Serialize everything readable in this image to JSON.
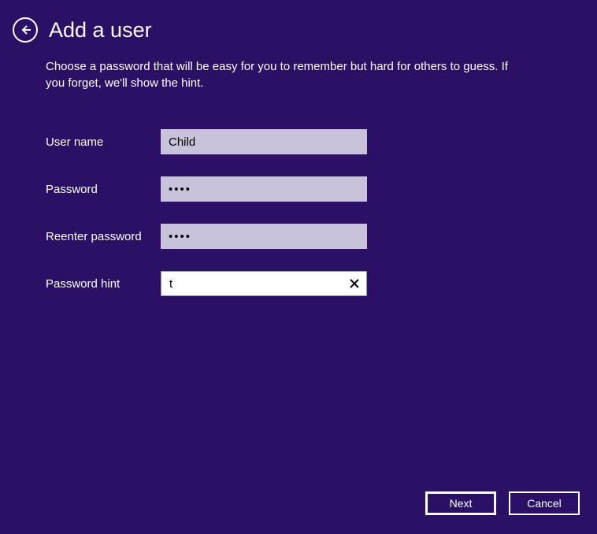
{
  "header": {
    "title": "Add a user"
  },
  "description": "Choose a password that will be easy for you to remember but hard for others to guess. If you forget, we'll show the hint.",
  "form": {
    "username": {
      "label": "User name",
      "value": "Child"
    },
    "password": {
      "label": "Password",
      "value": "••••"
    },
    "reenter": {
      "label": "Reenter password",
      "value": "••••"
    },
    "hint": {
      "label": "Password hint",
      "value": "t"
    }
  },
  "footer": {
    "next": "Next",
    "cancel": "Cancel"
  }
}
